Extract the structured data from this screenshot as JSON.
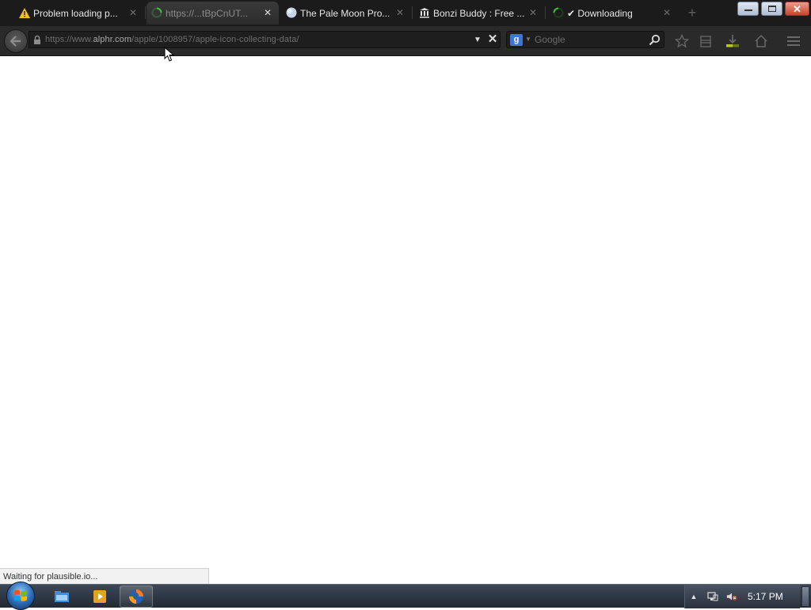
{
  "tabs": [
    {
      "title": "Problem loading p...",
      "icon": "warning-icon"
    },
    {
      "title": "https://...tBpCnUT...",
      "icon": "loading-spinner-icon",
      "active": true
    },
    {
      "title": "The Pale Moon Pro...",
      "icon": "moon-globe-icon"
    },
    {
      "title": "Bonzi Buddy : Free ...",
      "icon": "archive-building-icon"
    },
    {
      "title": "✔ Downloading",
      "icon": "loading-spinner-icon"
    }
  ],
  "url": {
    "prefix": "https://www.",
    "host": "alphr.com",
    "path": "/apple/1008957/apple-icon-collecting-data/"
  },
  "search": {
    "placeholder": "Google",
    "engine_letter": "g"
  },
  "status": {
    "text": "Waiting for plausible.io..."
  },
  "taskbar": {
    "clock": "5:17 PM"
  },
  "colors": {
    "chrome": "#2a2a2a",
    "tabstrip": "#1b1b1b",
    "accent_spinner": "#3fbf3f",
    "search_engine": "#3f74d6"
  }
}
